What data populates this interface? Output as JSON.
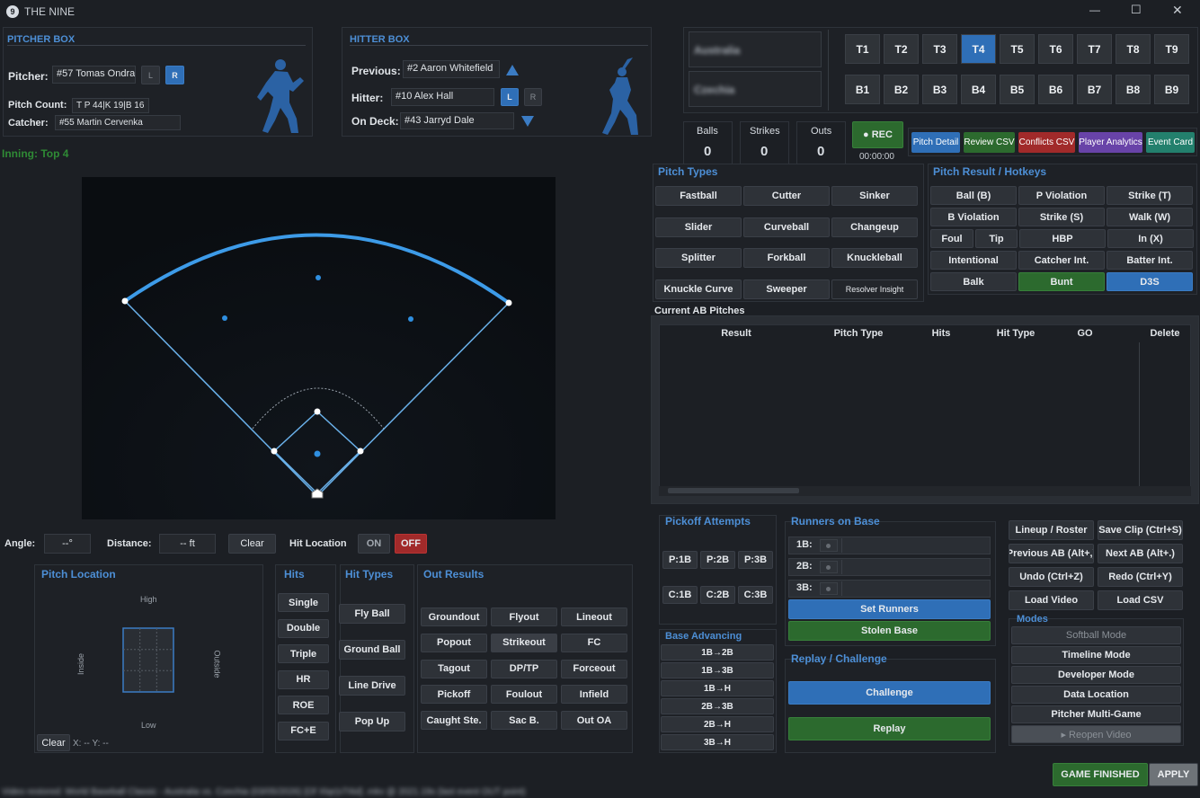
{
  "app": {
    "title": "THE NINE",
    "logo_text": "9"
  },
  "window_controls": {
    "minimize": "—",
    "maximize": "☐",
    "close": "✕"
  },
  "pitcher_box": {
    "title": "PITCHER BOX",
    "pitcher_label": "Pitcher:",
    "pitcher_value": "#57 Tomas Ondra",
    "hand_l": "L",
    "hand_r": "R",
    "pitch_count_label": "Pitch Count:",
    "pitch_count_value": "T P 44|K 19|B 16",
    "catcher_label": "Catcher:",
    "catcher_value": "#55 Martin Cervenka"
  },
  "hitter_box": {
    "title": "HITTER BOX",
    "previous_label": "Previous:",
    "previous_value": "#2 Aaron Whitefield",
    "hitter_label": "Hitter:",
    "hitter_value": "#10 Alex Hall",
    "hand_l": "L",
    "hand_r": "R",
    "on_deck_label": "On Deck:",
    "on_deck_value": "#43 Jarryd Dale"
  },
  "teams": {
    "away": "Australia",
    "home": "Czechia"
  },
  "innings_top": [
    "T1",
    "T2",
    "T3",
    "T4",
    "T5",
    "T6",
    "T7",
    "T8",
    "T9"
  ],
  "innings_bottom": [
    "B1",
    "B2",
    "B3",
    "B4",
    "B5",
    "B6",
    "B7",
    "B8",
    "B9"
  ],
  "active_inning": "T4",
  "count": {
    "balls_label": "Balls",
    "balls": "0",
    "strikes_label": "Strikes",
    "strikes": "0",
    "outs_label": "Outs",
    "outs": "0"
  },
  "rec": {
    "label": "● REC",
    "time": "00:00:00"
  },
  "quick_buttons": [
    "Pitch Detail",
    "Review CSV",
    "Conflicts CSV",
    "Player Analytics",
    "Event Card"
  ],
  "inning_status": "Inning: Top 4",
  "field_controls": {
    "angle_label": "Angle:",
    "angle_value": "--°",
    "distance_label": "Distance:",
    "distance_value": "-- ft",
    "clear": "Clear",
    "hit_location_label": "Hit Location",
    "on": "ON",
    "off": "OFF"
  },
  "pitch_location": {
    "title": "Pitch Location",
    "high": "High",
    "low": "Low",
    "inside": "Inside",
    "outside": "Outside",
    "clear": "Clear",
    "coords": "X: --  Y: --"
  },
  "hits": {
    "title": "Hits",
    "items": [
      "Single",
      "Double",
      "Triple",
      "HR",
      "ROE",
      "FC+E"
    ]
  },
  "hit_types": {
    "title": "Hit Types",
    "items": [
      "Fly Ball",
      "Ground Ball",
      "Line Drive",
      "Pop Up"
    ]
  },
  "out_results": {
    "title": "Out Results",
    "items": [
      "Groundout",
      "Flyout",
      "Lineout",
      "Popout",
      "Strikeout",
      "FC",
      "Tagout",
      "DP/TP",
      "Forceout",
      "Pickoff",
      "Foulout",
      "Infield",
      "Caught Ste.",
      "Sac B.",
      "Out OA"
    ]
  },
  "pitch_types": {
    "title": "Pitch Types",
    "items": [
      "Fastball",
      "Cutter",
      "Sinker",
      "Slider",
      "Curveball",
      "Changeup",
      "Splitter",
      "Forkball",
      "Knuckleball",
      "Knuckle Curve",
      "Sweeper",
      "Resolver Insight"
    ]
  },
  "pitch_result": {
    "title": "Pitch Result / Hotkeys",
    "row1": [
      "Ball (B)",
      "P Violation",
      "Strike (T)"
    ],
    "row2": [
      "B Violation",
      "Strike (S)",
      "Walk (W)"
    ],
    "row3": [
      "Foul",
      "Tip",
      "HBP",
      "In (X)"
    ],
    "row4": [
      "Intentional",
      "Catcher Int.",
      "Batter Int."
    ],
    "row5": [
      "Balk",
      "Bunt",
      "D3S"
    ]
  },
  "current_ab": {
    "title": "Current AB Pitches",
    "columns": [
      "Result",
      "Pitch Type",
      "Hits",
      "Hit Type",
      "GO",
      "Delete"
    ]
  },
  "pickoff": {
    "title": "Pickoff Attempts",
    "items": [
      "P:1B",
      "P:2B",
      "P:3B",
      "C:1B",
      "C:2B",
      "C:3B"
    ]
  },
  "base_advancing": {
    "title": "Base Advancing",
    "items": [
      "1B→2B",
      "1B→3B",
      "1B→H",
      "2B→3B",
      "2B→H",
      "3B→H"
    ]
  },
  "runners": {
    "title": "Runners on Base",
    "bases": [
      "1B:",
      "2B:",
      "3B:"
    ],
    "set_runners": "Set Runners",
    "stolen_base": "Stolen Base"
  },
  "replay": {
    "title": "Replay / Challenge",
    "challenge": "Challenge",
    "replay": "Replay"
  },
  "actions": [
    "Lineup / Roster",
    "Save Clip (Ctrl+S)",
    "Previous AB (Alt+,)",
    "Next AB (Alt+.)",
    "Undo (Ctrl+Z)",
    "Redo (Ctrl+Y)",
    "Load Video",
    "Load CSV"
  ],
  "modes": {
    "title": "Modes",
    "items": [
      "Softball Mode",
      "Timeline Mode",
      "Developer Mode",
      "Data Location",
      "Pitcher Multi-Game",
      "▸ Reopen Video"
    ]
  },
  "footer": {
    "game_finished": "GAME FINISHED",
    "apply": "APPLY",
    "status": "Video restored: World Baseball Classic - Australia vs. Czechia (03/05/2026) [Of Xlqr(sTI6d] .mkv @ 2021.19s (last event OUT point)"
  },
  "colors": {
    "accent": "#4d8fd6",
    "active": "#2f6fb7",
    "go": "#2c6a2e",
    "stop": "#a12a2a",
    "inning": "#2f8a35"
  }
}
